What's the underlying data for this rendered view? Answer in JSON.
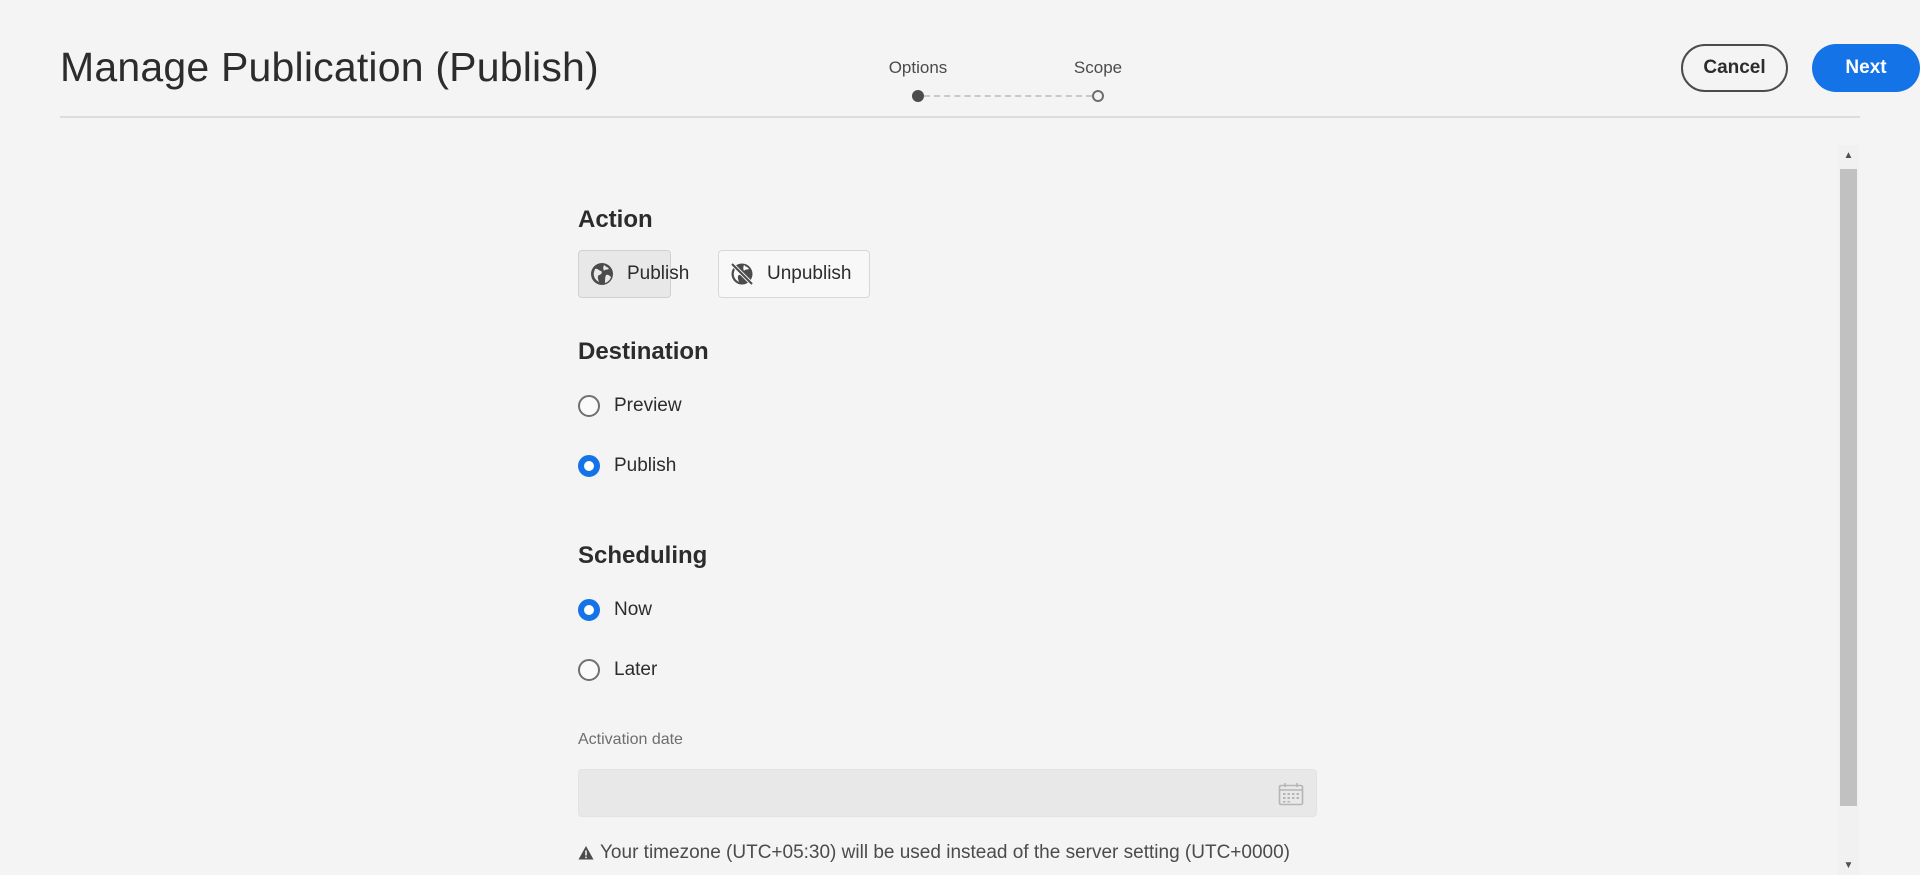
{
  "header": {
    "title": "Manage Publication (Publish)",
    "steps": [
      {
        "label": "Options",
        "state": "current"
      },
      {
        "label": "Scope",
        "state": "upcoming"
      }
    ],
    "cancel_label": "Cancel",
    "next_label": "Next"
  },
  "action": {
    "title": "Action",
    "options": [
      {
        "label": "Publish",
        "icon": "globe-icon",
        "selected": true
      },
      {
        "label": "Unpublish",
        "icon": "globe-off-icon",
        "selected": false
      }
    ]
  },
  "destination": {
    "title": "Destination",
    "options": [
      {
        "label": "Preview",
        "checked": false
      },
      {
        "label": "Publish",
        "checked": true
      }
    ]
  },
  "scheduling": {
    "title": "Scheduling",
    "options": [
      {
        "label": "Now",
        "checked": true
      },
      {
        "label": "Later",
        "checked": false
      }
    ],
    "activation_label": "Activation date",
    "activation_value": "",
    "calendar_icon": "calendar-icon",
    "notice": "Your timezone (UTC+05:30) will be used instead of the server setting (UTC+0000)",
    "notice_icon": "alert-icon"
  },
  "colors": {
    "accent": "#1473e6",
    "background": "#f4f4f4",
    "text": "#2c2c2c"
  }
}
